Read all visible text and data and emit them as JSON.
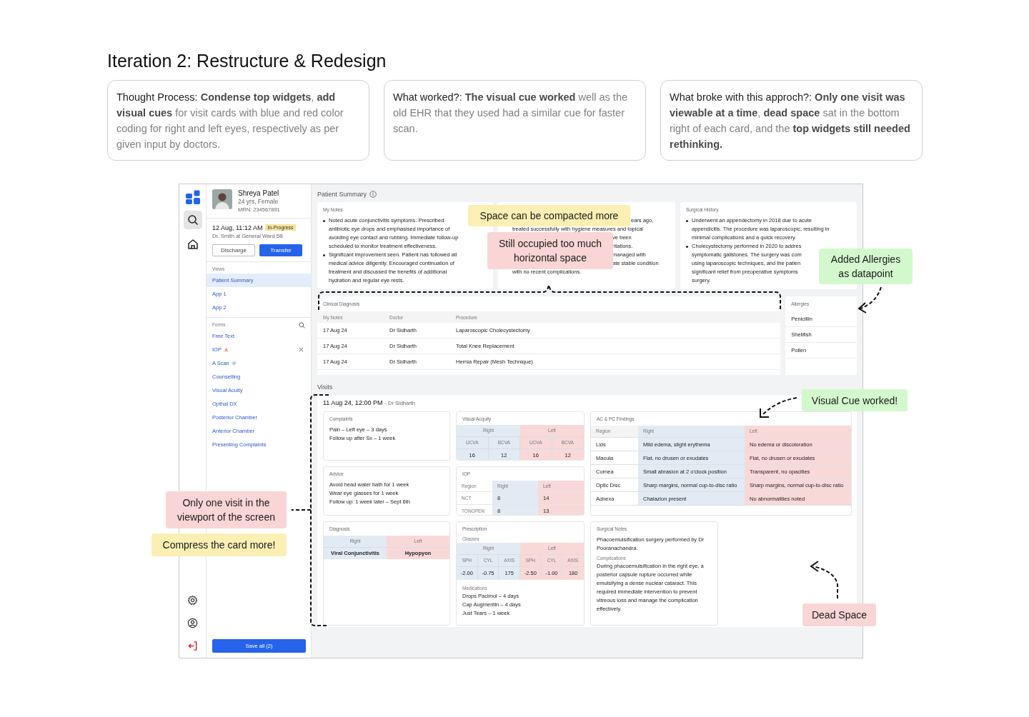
{
  "page_title": "Iteration 2: Restructure & Redesign",
  "notes": [
    {
      "label": "Thought Process:",
      "body": "**Condense top widgets**, **add visual cues** for visit cards with blue and red color coding for right and left eyes, respectively as per given input by doctors."
    },
    {
      "label": "What worked?:",
      "body": "**The visual cue worked** well as the old EHR that they used had a similar cue for faster scan."
    },
    {
      "label": "What broke with this approch?:",
      "body": "**Only one visit was viewable at a time**, **dead space** sat in the bottom right of each card, and the **top widgets still needed rethinking.**"
    }
  ],
  "app": {
    "rail": {
      "top": [
        {
          "kind": "search",
          "selected": true
        },
        {
          "kind": "home",
          "selected": false
        }
      ],
      "bottom": [
        {
          "kind": "settings"
        },
        {
          "kind": "profile"
        },
        {
          "kind": "logout"
        }
      ]
    },
    "patient": {
      "name": "Shreya Patel",
      "details": "24 yrs, Female",
      "mrn": "MRN: 234567891",
      "timestamp": "12 Aug, 11:12 AM",
      "status": "In-Progress",
      "location": "Dr. Smith at General Ward 5B"
    },
    "actions": [
      {
        "label": "Discharge",
        "primary": false
      },
      {
        "label": "Transfer",
        "primary": true
      }
    ],
    "views": {
      "title": "Views",
      "items": [
        {
          "label": "Patient Summary",
          "selected": true
        },
        {
          "label": "App 1",
          "selected": false
        },
        {
          "label": "App 2",
          "selected": false
        }
      ]
    },
    "forms": {
      "title": "Forms",
      "items": [
        {
          "label": "Free Text",
          "kind": "plain",
          "removable": false
        },
        {
          "label": "IOP",
          "kind": "warning",
          "removable": true
        },
        {
          "label": "A Scan",
          "kind": "verified",
          "removable": false
        },
        {
          "label": "Counselling",
          "kind": "plain",
          "removable": false
        },
        {
          "label": "Visual Acuity",
          "kind": "plain",
          "removable": false
        },
        {
          "label": "Opthal DX",
          "kind": "plain",
          "removable": false
        },
        {
          "label": "Posterior Chamber",
          "kind": "plain",
          "removable": false
        },
        {
          "label": "Anterior Chamber",
          "kind": "plain",
          "removable": false
        },
        {
          "label": "Presenting Complaints",
          "kind": "plain",
          "removable": false
        }
      ]
    },
    "save_button": "Save all (2)",
    "summary": {
      "title": "Patient Summary",
      "cards": [
        {
          "kind": "bullets",
          "title": "My Notes",
          "bullets": [
            "Noted acute conjunctivitis symptoms. Prescribed\nantibiotic eye drops and emphasised importance of\navoiding eye contact and rubbing. Immediate follow-up\nscheduled to monitor treatment effectiveness.",
            "Significant improvement seen. Patient has followed all\nmedical advice diligently. Encouraged continuation of\ntreatment and discussed the benefits of additional\nhydration and regular eye rests."
          ]
        },
        {
          "kind": "covered",
          "lines": [
            {
              "text": "ears ago,",
              "kind": "after-top-note"
            },
            {
              "text": "treated successfully with hygiene measures and topical",
              "kind": "start"
            },
            {
              "text": "ve been",
              "kind": "after-note"
            },
            {
              "text": "ritations.",
              "kind": "after-note"
            },
            {
              "text": "managed with",
              "kind": "after-note"
            },
            {
              "text": "ate stable condition",
              "kind": "after-note"
            },
            {
              "text": "with no recent complications.",
              "kind": "start"
            }
          ]
        },
        {
          "kind": "bullets",
          "title": "Surgical History",
          "bullets": [
            "Underwent an appendectomy in 2018 due to acute\nappendicitis. The procedure was laparoscopic, resulting in\nminimal complications and a quick recovery.",
            "Cholecystectomy performed in 2020 to addres\nsymptomatic gallstones. The surgery was com\nusing laparoscopic techniques, and the patien\nsignificant relief from preoperative symptoms\nsurgery."
          ]
        }
      ]
    },
    "clinical": {
      "title": "Clinical Diagnosis",
      "columns": [
        "My Notes",
        "Doctor",
        "Procedure"
      ],
      "rows": [
        [
          "17 Aug 24",
          "Dr Sidharth",
          "Laparoscopic Cholecystectomy"
        ],
        [
          "17 Aug 24",
          "Dr Sidharth",
          "Total Knee Replacement"
        ],
        [
          "17 Aug 24",
          "Dr Sidharth",
          "Hernia Repair (Mesh Technique)"
        ]
      ]
    },
    "allergies": {
      "title": "Allergies",
      "items": [
        "Penicillin",
        "Shellfish",
        "Pollen"
      ]
    },
    "visits": {
      "title": "Visits",
      "visit": {
        "date": "11 Aug 24, 12:00 PM",
        "doctor": "- Dr Sidharth",
        "complaints": {
          "title": "Complaints",
          "lines": [
            "Pain – Left eye – 3 days",
            "Follow up after Sx – 1 week"
          ]
        },
        "visual_acuity": {
          "title": "Visual Acquity",
          "groups": [
            {
              "label": "Right",
              "kind": "right",
              "columns": [
                "UCVA",
                "BCVA"
              ],
              "values": [
                "16",
                "12"
              ]
            },
            {
              "label": "Left",
              "kind": "left",
              "columns": [
                "UCVA",
                "BCVA"
              ],
              "values": [
                "16",
                "12"
              ]
            }
          ]
        },
        "findings": {
          "title": "AC & PC Findings",
          "columns": [
            {
              "label": "Region",
              "kind": "plain"
            },
            {
              "label": "Right",
              "kind": "right"
            },
            {
              "label": "Left",
              "kind": "left"
            }
          ],
          "rows": [
            [
              "Lids",
              "Mild edema, slight erythema",
              "No edema or discoloration"
            ],
            [
              "Macula",
              "Flat, no drusen or exudates",
              "Flat, no drusen or exudates"
            ],
            [
              "Cornea",
              "Small abrasion at 2 o'clock position",
              "Transparent, no opacities"
            ],
            [
              "Optic Disc",
              "Sharp margins, normal cup-to-disc ratio",
              "Sharp margins, normal cup-to-disc ratio"
            ],
            [
              "Adnexa",
              "Chalazion present",
              "No abnormalities noted"
            ]
          ]
        },
        "advice": {
          "title": "Advice",
          "lines": [
            "Avoid head water bath for 1 week",
            "Wear eye glasses for 1 week",
            "Follow up: 1 week later – Sept 6th"
          ]
        },
        "iop": {
          "title": "IOP",
          "columns": [
            {
              "label": "Region",
              "kind": "plain"
            },
            {
              "label": "Right",
              "kind": "right"
            },
            {
              "label": "Left",
              "kind": "left"
            }
          ],
          "rows": [
            [
              "NCT",
              "8",
              "14"
            ],
            [
              "TONOPEN",
              "8",
              "13"
            ]
          ]
        },
        "diagnosis": {
          "title": "Diagnosis",
          "columns": [
            {
              "label": "Right",
              "kind": "right"
            },
            {
              "label": "Left",
              "kind": "left"
            }
          ],
          "rows": [
            [
              "Viral Conjunctivitis",
              "Hypopyon"
            ]
          ]
        },
        "prescription": {
          "title": "Prescription",
          "glasses_title": "Glasses",
          "groups": [
            {
              "label": "Right",
              "kind": "right",
              "columns": [
                "SPH",
                "CYL",
                "AXIS"
              ],
              "values": [
                "-2.00",
                "-0.75",
                "175"
              ]
            },
            {
              "label": "Left",
              "kind": "left",
              "columns": [
                "SPH",
                "CYL",
                "AXIS"
              ],
              "values": [
                "-2.50",
                "-1.00",
                "180"
              ]
            }
          ],
          "medications_title": "Medications",
          "medications": [
            "Drops Pacimol – 4 days",
            "Cap Augmentin – 4 days",
            "Just Tears – 1 week"
          ]
        },
        "surgical_notes": {
          "title": "Surgical Notes",
          "text": "Phacoemulsification surgery performed by Dr Pooranachandra.",
          "complications_title": "Complications",
          "complications": "During phacoemulsification in the right eye, a posterior capsule rupture occurred while emulsifying a dense nuclear cataract. This required immediate intervention to prevent vitreous loss and manage the complication effectively."
        }
      }
    }
  },
  "annotations": [
    {
      "text": "Space can be compacted more",
      "kind": "suggestion"
    },
    {
      "text": "Still occupied too much horizontal space",
      "kind": "problem"
    },
    {
      "text": "Added Allergies as datapoint",
      "kind": "success"
    },
    {
      "text": "Visual Cue worked!",
      "kind": "success"
    },
    {
      "text": "Only one visit in the viewport of the screen",
      "kind": "problem"
    },
    {
      "text": "Compress the card more!",
      "kind": "suggestion"
    },
    {
      "text": "Dead Space",
      "kind": "problem"
    }
  ]
}
